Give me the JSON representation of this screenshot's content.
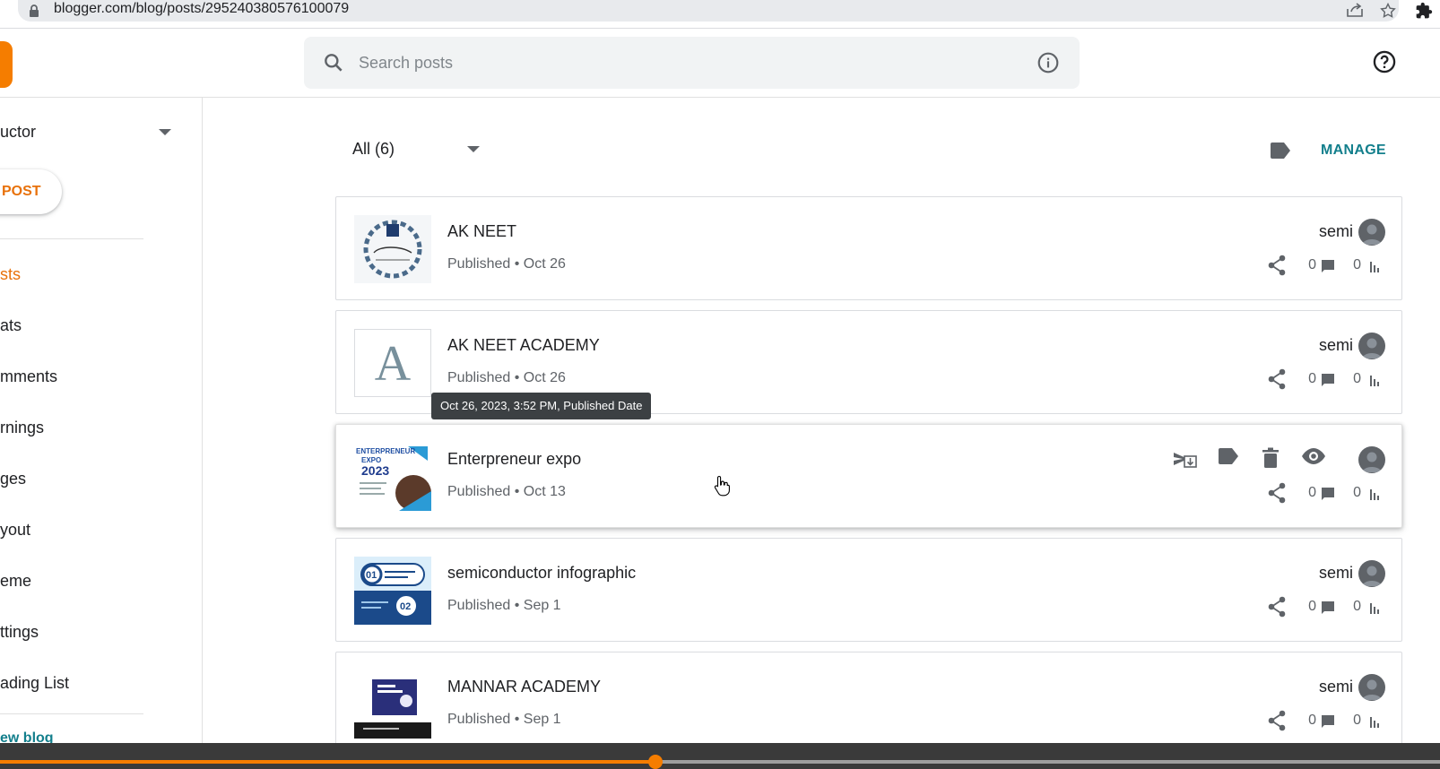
{
  "browser": {
    "url": "blogger.com/blog/posts/295240380576100079"
  },
  "header": {
    "search_placeholder": "Search posts"
  },
  "sidebar": {
    "blog_name": "uctor",
    "new_post_label": "POST",
    "items": [
      {
        "label": "sts",
        "active": true
      },
      {
        "label": "ats",
        "active": false
      },
      {
        "label": "mments",
        "active": false
      },
      {
        "label": "rnings",
        "active": false
      },
      {
        "label": "ges",
        "active": false
      },
      {
        "label": "yout",
        "active": false
      },
      {
        "label": "eme",
        "active": false
      },
      {
        "label": "ttings",
        "active": false
      },
      {
        "label": "ading List",
        "active": false
      }
    ],
    "view_blog_label": "ew blog"
  },
  "toolbar": {
    "filter_label": "All (6)",
    "manage_label": "MANAGE"
  },
  "posts": [
    {
      "title": "AK NEET",
      "status": "Published • Oct 26",
      "author": "semi",
      "comments": "0",
      "views": "0",
      "thumb": "thank-you-wreath"
    },
    {
      "title": "AK NEET ACADEMY",
      "status": "Published • Oct 26",
      "author": "semi",
      "comments": "0",
      "views": "0",
      "thumb": "letter-placeholder",
      "thumb_letter": "A"
    },
    {
      "title": "Enterpreneur expo",
      "status": "Published • Oct 13",
      "author": "",
      "comments": "0",
      "views": "0",
      "thumb": "expo-poster"
    },
    {
      "title": "semiconductor infographic",
      "status": "Published • Sep 1",
      "author": "semi",
      "comments": "0",
      "views": "0",
      "thumb": "infographic"
    },
    {
      "title": "MANNAR ACADEMY",
      "status": "Published • Sep 1",
      "author": "semi",
      "comments": "0",
      "views": "0",
      "thumb": "academy-poster"
    }
  ],
  "tooltip": "Oct 26, 2023, 3:52 PM, Published Date",
  "thumb_text": {
    "expo_line1": "ENTERPRENEUR",
    "expo_line2": "EXPO",
    "expo_year": "2023",
    "info_01": "01",
    "info_02": "02"
  },
  "video_progress": 0.455,
  "colors": {
    "accent_orange": "#e8710a",
    "link_teal": "#137f8c",
    "icon_grey": "#5f6368"
  }
}
